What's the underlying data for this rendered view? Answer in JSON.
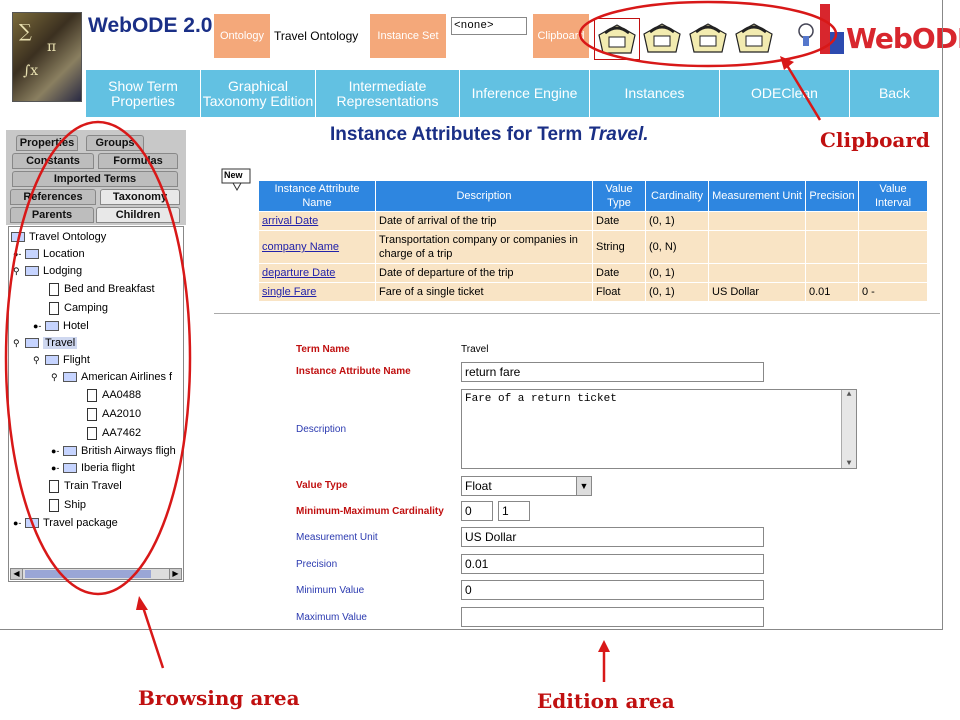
{
  "header": {
    "app_title": "WebODE 2.0",
    "ontology_button": "Ontology",
    "ontology_value": "Travel Ontology",
    "instance_set_button": "Instance Set",
    "instance_set_value": "<none>",
    "clipboard_button": "Clipboard",
    "brand_logo_text": "WebODE"
  },
  "nav": {
    "items": [
      {
        "label": "Show Term Properties"
      },
      {
        "label": "Graphical Taxonomy Edition"
      },
      {
        "label": "Intermediate Representations"
      },
      {
        "label": "Inference Engine"
      },
      {
        "label": "Instances"
      },
      {
        "label": "ODEClean"
      },
      {
        "label": "Back"
      }
    ]
  },
  "tabs": {
    "properties": "Properties",
    "groups": "Groups",
    "constants": "Constants",
    "formulas": "Formulas",
    "imported_terms": "Imported Terms",
    "references": "References",
    "taxonomy": "Taxonomy",
    "parents": "Parents",
    "children": "Children"
  },
  "tree": {
    "nodes": [
      {
        "label": "Travel Ontology"
      },
      {
        "label": "Location"
      },
      {
        "label": "Lodging"
      },
      {
        "label": "Bed and Breakfast"
      },
      {
        "label": "Camping"
      },
      {
        "label": "Hotel"
      },
      {
        "label": "Travel"
      },
      {
        "label": "Flight"
      },
      {
        "label": "American Airlines f"
      },
      {
        "label": "AA0488"
      },
      {
        "label": "AA2010"
      },
      {
        "label": "AA7462"
      },
      {
        "label": "British Airways fligh"
      },
      {
        "label": "Iberia flight"
      },
      {
        "label": "Train Travel"
      },
      {
        "label": "Ship"
      },
      {
        "label": "Travel package"
      }
    ]
  },
  "content": {
    "title_prefix": "Instance Attributes for Term",
    "title_term": "Travel.",
    "new_icon_label": "New",
    "table": {
      "headers": [
        "Instance Attribute Name",
        "Description",
        "Value Type",
        "Cardinality",
        "Measurement Unit",
        "Precision",
        "Value Interval"
      ],
      "rows": [
        [
          "arrival Date",
          "Date of arrival of the trip",
          "Date",
          "(0, 1)",
          "",
          "",
          ""
        ],
        [
          "company Name",
          "Transportation company or companies in charge of a trip",
          "String",
          "(0, N)",
          "",
          "",
          ""
        ],
        [
          "departure Date",
          "Date of departure of the trip",
          "Date",
          "(0, 1)",
          "",
          "",
          ""
        ],
        [
          "single Fare",
          "Fare of a single ticket",
          "Float",
          "(0, 1)",
          "US Dollar",
          "0.01",
          "0 -"
        ]
      ]
    }
  },
  "form": {
    "term_name_label": "Term Name",
    "term_name_value": "Travel",
    "attr_name_label": "Instance Attribute Name",
    "attr_name_value": "return fare",
    "description_label": "Description",
    "description_value": "Fare of a return ticket",
    "value_type_label": "Value Type",
    "value_type_value": "Float",
    "cardinality_label": "Minimum-Maximum Cardinality",
    "cardinality_min": "0",
    "cardinality_max": "1",
    "measurement_unit_label": "Measurement Unit",
    "measurement_unit_value": "US Dollar",
    "precision_label": "Precision",
    "precision_value": "0.01",
    "minimum_value_label": "Minimum Value",
    "minimum_value_value": "0",
    "maximum_value_label": "Maximum Value",
    "maximum_value_value": ""
  },
  "annotations": {
    "clipboard": "Clipboard",
    "browsing_area": "Browsing area",
    "edition_area": "Edition area"
  },
  "colors": {
    "nav_bg": "#62c1e2",
    "header_box": "#f4a87a",
    "table_header": "#2e86e0",
    "table_cell": "#f9e4c5",
    "annotation_red": "#c01010",
    "title_blue": "#1a2f86"
  }
}
